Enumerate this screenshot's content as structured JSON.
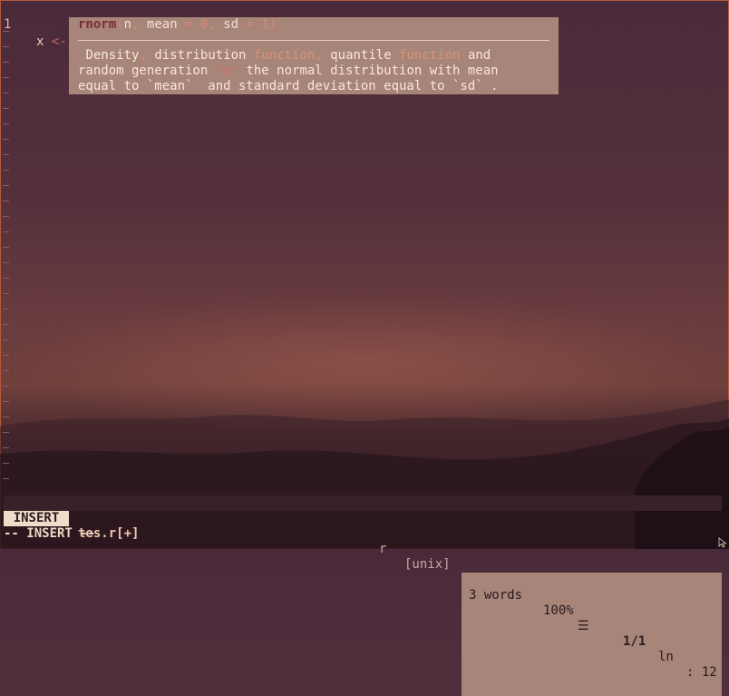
{
  "editor": {
    "line_number": "1",
    "code": {
      "var": "x",
      "op": "<-",
      "fn": "rnorm",
      "paren": "("
    }
  },
  "popup": {
    "signature": {
      "fn": "rnorm",
      "open": "(",
      "arg1": "n",
      "comma1": ",",
      "arg2": "mean",
      "eq2": "=",
      "val2": "0",
      "comma2": ",",
      "arg3": "sd",
      "eq3": "=",
      "val3": "1",
      "close": ")"
    },
    "doc": {
      "l1": {
        "a": "Density",
        "b": ",",
        "c": " distribution ",
        "d": "function",
        "e": ",",
        "f": " quantile ",
        "g": "function",
        "h": " and"
      },
      "l2": {
        "a": "random generation ",
        "b": "for",
        "c": " the normal distribution with mean"
      },
      "l3": "equal to `mean`  and standard deviation equal to `sd` ."
    }
  },
  "status": {
    "mode": "INSERT",
    "file": "tes.r[+]",
    "filetype": "r",
    "fileformat": "[unix]",
    "words": "3 words",
    "percent": "100%",
    "lines_icon": "☰",
    "position": "1/1",
    "ln_label": "ln",
    "col": ": 12"
  },
  "cmdline": "-- INSERT --",
  "icons": {
    "mouse": "mouse-pointer-icon"
  }
}
